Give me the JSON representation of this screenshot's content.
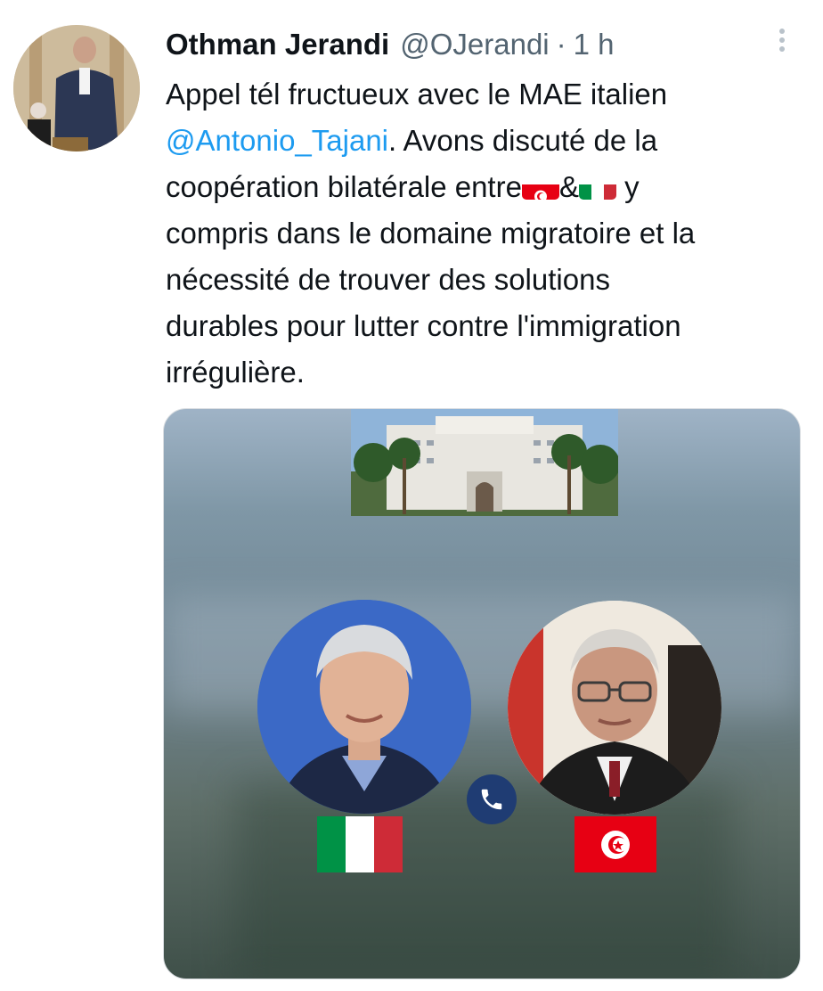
{
  "tweet": {
    "author_name": "Othman Jerandi",
    "author_handle": "@OJerandi",
    "separator": "·",
    "time": "1 h",
    "lines": {
      "l1": "Appel tél fructueux avec le MAE italien",
      "l2_mention": "@Antonio_Tajani",
      "l2_rest": ". Avons discuté de la",
      "l3_a": "coopération bilatérale entre",
      "l3_b": "&",
      "l3_c": " y",
      "l4": "compris dans le domaine migratoire et la",
      "l5": "nécessité de trouver des solutions",
      "l6": "durables pour lutter contre l'immigration",
      "l7": "irrégulière."
    },
    "colors": {
      "mention": "#1d9bf0",
      "secondary_text": "#536471",
      "primary_text": "#0f1419",
      "phone_badge": "#1f3c73",
      "italy_flag": [
        "#009246",
        "#ffffff",
        "#ce2b37"
      ],
      "tunisia_flag": "#e70013"
    },
    "icons": {
      "more": "more-vertical-icon",
      "phone": "phone-icon",
      "flag_tunisia": "tunisia-flag-icon",
      "flag_italy": "italy-flag-icon"
    }
  }
}
